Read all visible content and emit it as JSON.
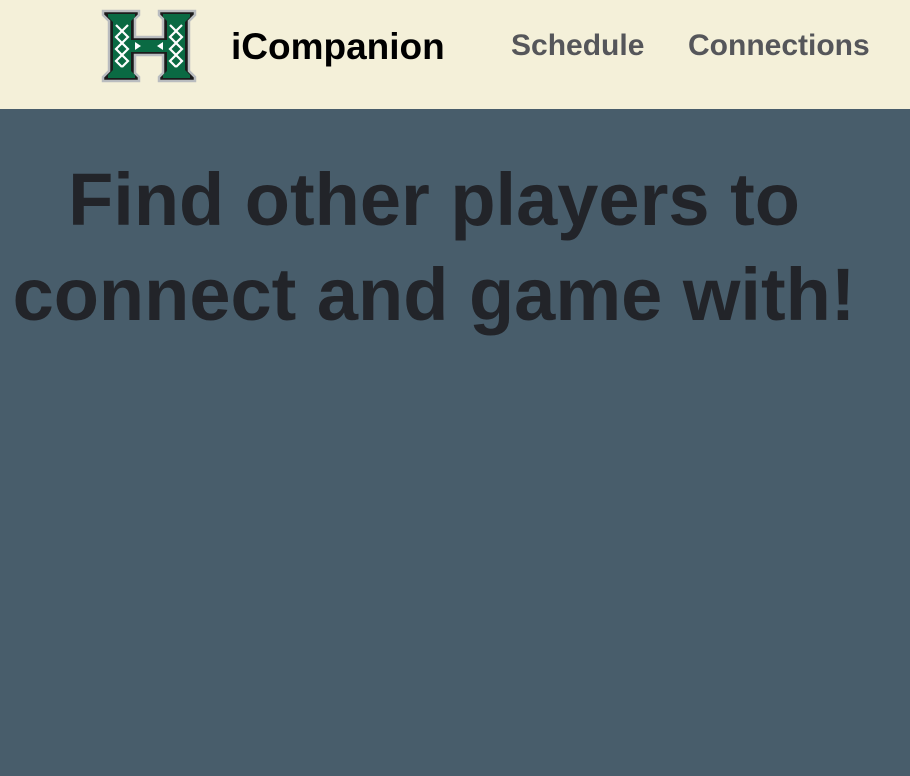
{
  "navbar": {
    "brand_name": "iCompanion",
    "logo_icon": "hawaii-h-logo-icon",
    "links": [
      {
        "label": "Schedule"
      },
      {
        "label": "Connections"
      }
    ]
  },
  "hero": {
    "heading": "Find other players to connect and game with!"
  },
  "colors": {
    "navbar_bg": "#f4f0d9",
    "page_bg": "#485d6b",
    "heading_text": "#222429",
    "nav_link_text": "#55565a",
    "logo_green": "#0a6a43"
  }
}
